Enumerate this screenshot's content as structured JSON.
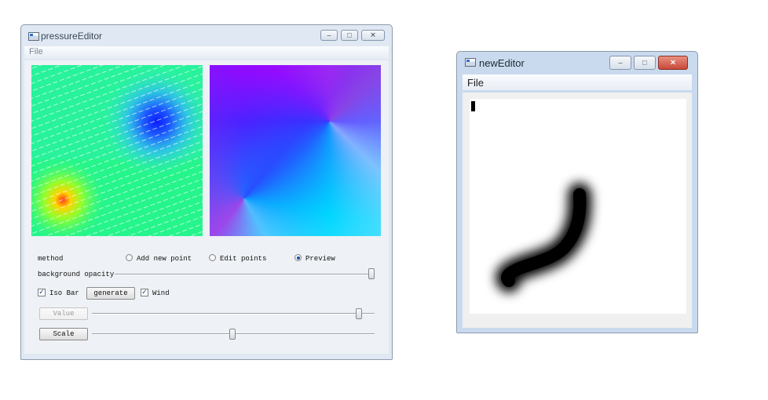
{
  "pressure_window": {
    "title": "pressureEditor",
    "menu": [
      "File"
    ],
    "controls": {
      "method_label": "method",
      "radio_add": "Add new point",
      "radio_edit": "Edit points",
      "radio_preview": "Preview",
      "selected_method": "Preview",
      "bg_opacity_label": "background opacity",
      "bg_opacity_value": 1.0,
      "iso_bar_label": "Iso Bar",
      "iso_bar_checked": true,
      "generate_label": "generate",
      "wind_label": "Wind",
      "wind_checked": true,
      "value_label": "Value",
      "value_slider": 0.95,
      "scale_label": "Scale",
      "scale_slider": 0.5
    }
  },
  "new_window": {
    "title": "newEditor",
    "menu": [
      "File"
    ]
  },
  "icons": {
    "minimize": "minimize-icon",
    "maximize": "maximize-icon",
    "close": "close-icon"
  },
  "colors": {
    "close_button": "#c8493a",
    "window_frame": "#dfe8f3"
  }
}
